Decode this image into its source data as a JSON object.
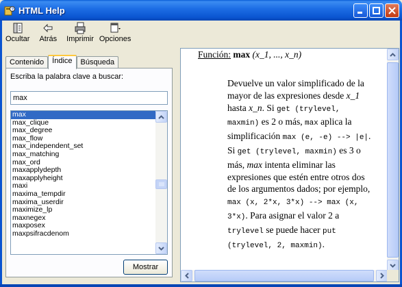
{
  "window": {
    "title": "HTML Help",
    "icon": "help-book-icon"
  },
  "toolbar": {
    "buttons": [
      {
        "label": "Ocultar",
        "icon": "hide-pane-icon"
      },
      {
        "label": "Atrás",
        "icon": "back-arrow-icon"
      },
      {
        "label": "Imprimir",
        "icon": "printer-icon"
      },
      {
        "label": "Opciones",
        "icon": "options-icon"
      }
    ]
  },
  "tabs": [
    {
      "label": "Contenido",
      "active": false
    },
    {
      "label": "Índice",
      "active": true
    },
    {
      "label": "Búsqueda",
      "active": false
    }
  ],
  "index": {
    "prompt": "Escriba la palabra clave a buscar:",
    "search_value": "max",
    "items": [
      "max",
      "max_clique",
      "max_degree",
      "max_flow",
      "max_independent_set",
      "max_matching",
      "max_ord",
      "maxapplydepth",
      "maxapplyheight",
      "maxi",
      "maxima_tempdir",
      "maxima_userdir",
      "maximize_lp",
      "maxnegex",
      "maxposex",
      "maxpsifracdenom"
    ],
    "selected": "max",
    "show_button": "Mostrar"
  },
  "content": {
    "func_label": "Función:",
    "func_name": "max",
    "func_args": "(x_1, ..., x_n)",
    "p1": "Devuelve un valor simplificado de la mayor de las expresiones desde",
    "x1": "x_1",
    "hasta": "hasta",
    "xn": "x_n",
    "si1": ". Si",
    "get1": "get (trylevel, maxmin)",
    "es2": "es 2 o más,",
    "max1": "max",
    "aplica": "aplica la simplificación",
    "code1": "max (e, -e) --> |e|",
    "si2": ". Si",
    "get2": "get (trylevel, maxmin)",
    "es3": "es 3 o más,",
    "max_it": "max",
    "intenta": "intenta eliminar las expresiones que estén entre otros dos de los argumentos dados; por ejemplo,",
    "code2": "max (x, 2*x, 3*x) --> max (x, 3*x)",
    "para": ". Para asignar el valor 2 a",
    "trylevel": "trylevel",
    "puede": "se puede hacer",
    "code3": "put (trylevel, 2, maxmin)",
    "end": "."
  }
}
